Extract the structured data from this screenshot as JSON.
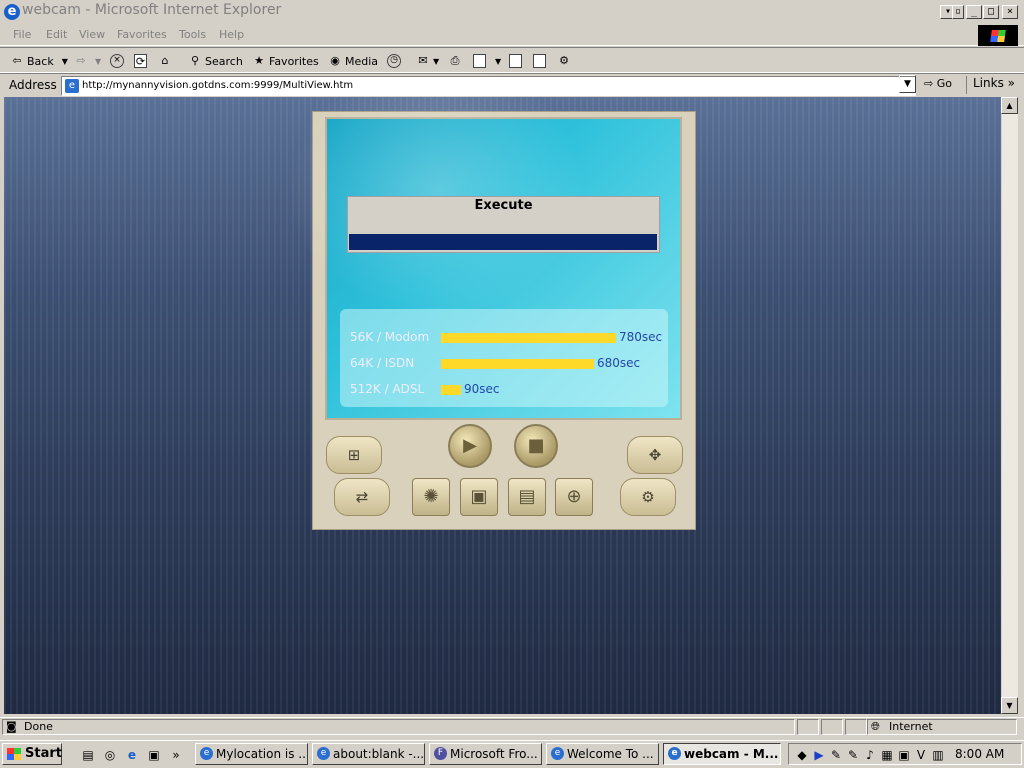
{
  "window": {
    "title": "webcam - Microsoft Internet Explorer",
    "caption_buttons": [
      "▾",
      "▫",
      "_",
      "□",
      "×"
    ]
  },
  "menu": [
    "File",
    "Edit",
    "View",
    "Favorites",
    "Tools",
    "Help"
  ],
  "toolbar": {
    "back": "Back",
    "search": "Search",
    "favorites": "Favorites",
    "media": "Media"
  },
  "address": {
    "label": "Address",
    "url": "http://mynannyvision.gotdns.com:9999/MultiView.htm",
    "go": "Go",
    "links": "Links"
  },
  "player": {
    "execute_label": "Execute",
    "execute_progress": 1.0,
    "speeds": [
      {
        "label": "56K / Modom",
        "value": "780sec",
        "seconds": 780
      },
      {
        "label": "64K / ISDN",
        "value": "680sec",
        "seconds": 680
      },
      {
        "label": "512K / ADSL",
        "value": "90sec",
        "seconds": 90
      }
    ],
    "icons": [
      "network-icon",
      "transfer-icon",
      "play-icon",
      "stop-icon",
      "camera-shutter-icon",
      "monitor-icon",
      "save-disk-icon",
      "zoom-in-icon",
      "ptz-control-icon",
      "device-settings-icon"
    ]
  },
  "status": {
    "text": "Done",
    "zone": "Internet"
  },
  "taskbar": {
    "start": "Start",
    "tasks": [
      {
        "label": "Mylocation is ...",
        "active": false
      },
      {
        "label": "about:blank -...",
        "active": false
      },
      {
        "label": "Microsoft Fro...",
        "active": false
      },
      {
        "label": "Welcome To ...",
        "active": false
      },
      {
        "label": "webcam - M...",
        "active": true
      }
    ],
    "clock": "8:00 AM"
  }
}
